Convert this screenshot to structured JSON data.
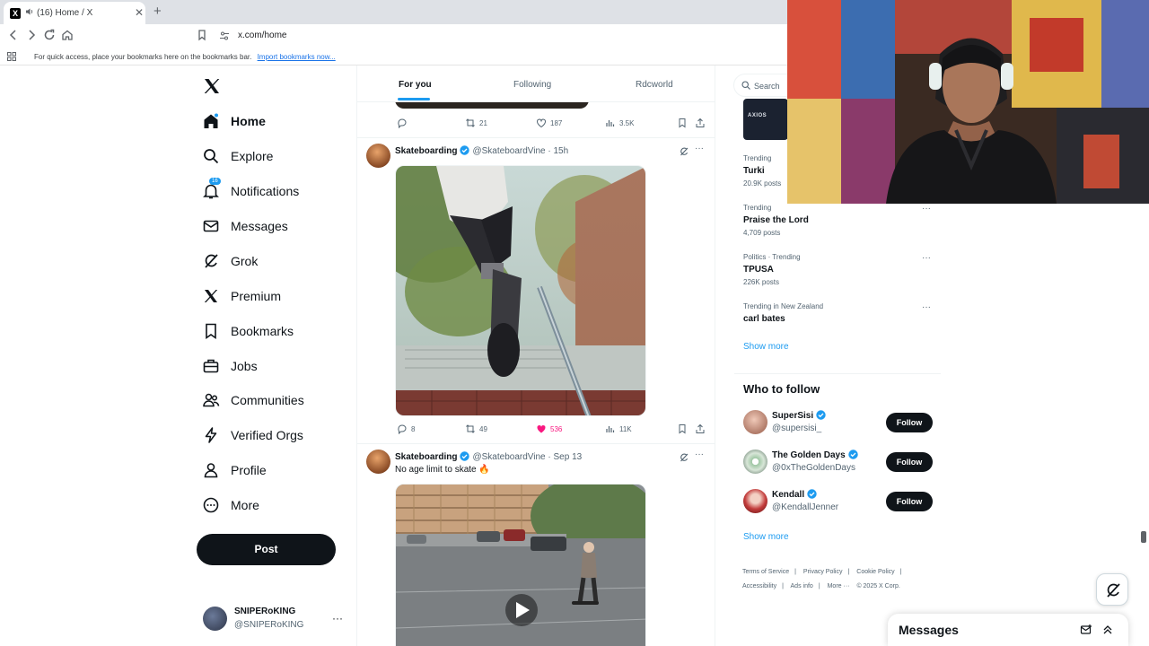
{
  "browser": {
    "tab_title": "(16) Home / X",
    "tab_favicon": "X",
    "url": "x.com/home",
    "bookmarks_message": "For quick access, place your bookmarks here on the bookmarks bar.",
    "bookmarks_link": "Import bookmarks now..."
  },
  "nav": {
    "items": [
      {
        "label": "Home",
        "icon": "home-icon"
      },
      {
        "label": "Explore",
        "icon": "search-icon"
      },
      {
        "label": "Notifications",
        "icon": "bell-icon",
        "badge": "16"
      },
      {
        "label": "Messages",
        "icon": "envelope-icon"
      },
      {
        "label": "Grok",
        "icon": "grok-icon"
      },
      {
        "label": "Premium",
        "icon": "x-logo-icon"
      },
      {
        "label": "Bookmarks",
        "icon": "bookmark-icon"
      },
      {
        "label": "Jobs",
        "icon": "briefcase-icon"
      },
      {
        "label": "Communities",
        "icon": "people-icon"
      },
      {
        "label": "Verified Orgs",
        "icon": "lightning-icon"
      },
      {
        "label": "Profile",
        "icon": "person-icon"
      },
      {
        "label": "More",
        "icon": "more-circle-icon"
      }
    ],
    "post_label": "Post",
    "account": {
      "name": "SNIPERoKING",
      "handle": "@SNIPERoKING"
    }
  },
  "feed": {
    "tabs": [
      "For you",
      "Following",
      "Rdcworld"
    ],
    "prev_actions": {
      "replies": "",
      "reposts": "21",
      "likes": "187",
      "views": "3.5K"
    },
    "tweets": [
      {
        "name": "Skateboarding",
        "handle": "@SkateboardVine",
        "time": "15h",
        "text": "",
        "actions": {
          "replies": "8",
          "reposts": "49",
          "likes": "536",
          "views": "11K"
        }
      },
      {
        "name": "Skateboarding",
        "handle": "@SkateboardVine",
        "time": "Sep 13",
        "text": "No age limit to skate 🔥",
        "actions": {}
      }
    ]
  },
  "sidebar": {
    "search_placeholder": "Search",
    "axios_label": "AXIOS",
    "trends": [
      {
        "context": "Trending",
        "title": "Turki",
        "count": "20.9K posts"
      },
      {
        "context": "Trending",
        "title": "Praise the Lord",
        "count": "4,709 posts"
      },
      {
        "context": "Politics · Trending",
        "title": "TPUSA",
        "count": "226K posts"
      },
      {
        "context": "Trending in New Zealand",
        "title": "carl bates",
        "count": ""
      }
    ],
    "show_more": "Show more",
    "who_to_follow_title": "Who to follow",
    "follow_suggestions": [
      {
        "name": "SuperSisi",
        "handle": "@supersisi_"
      },
      {
        "name": "The Golden Days",
        "handle": "@0xTheGoldenDays"
      },
      {
        "name": "Kendall",
        "handle": "@KendallJenner"
      }
    ],
    "follow_label": "Follow",
    "footer_links": [
      "Terms of Service",
      "Privacy Policy",
      "Cookie Policy",
      "Accessibility",
      "Ads info",
      "More ···",
      "© 2025 X Corp."
    ]
  },
  "messages_drawer": {
    "title": "Messages"
  },
  "colors": {
    "accent": "#1d9bf0",
    "like": "#f91880",
    "text": "#0f1419",
    "muted": "#536471"
  }
}
